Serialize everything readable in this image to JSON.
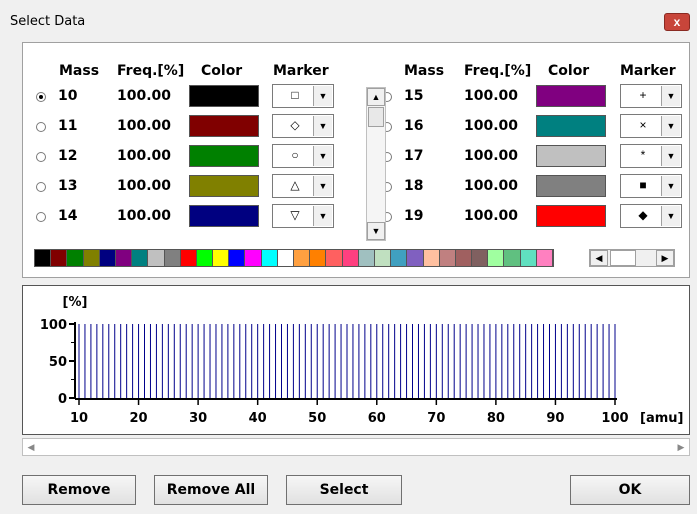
{
  "window": {
    "title": "Select Data",
    "close_label": "x"
  },
  "columns": {
    "mass": "Mass",
    "freq": "Freq.[%]",
    "color": "Color",
    "marker": "Marker"
  },
  "left_rows": [
    {
      "mass": "10",
      "freq": "100.00",
      "color": "#000000",
      "marker": "□",
      "selected": true
    },
    {
      "mass": "11",
      "freq": "100.00",
      "color": "#800000",
      "marker": "◇",
      "selected": false
    },
    {
      "mass": "12",
      "freq": "100.00",
      "color": "#008000",
      "marker": "○",
      "selected": false
    },
    {
      "mass": "13",
      "freq": "100.00",
      "color": "#808000",
      "marker": "△",
      "selected": false
    },
    {
      "mass": "14",
      "freq": "100.00",
      "color": "#000080",
      "marker": "▽",
      "selected": false
    }
  ],
  "right_rows": [
    {
      "mass": "15",
      "freq": "100.00",
      "color": "#800080",
      "marker": "+",
      "selected": false
    },
    {
      "mass": "16",
      "freq": "100.00",
      "color": "#008080",
      "marker": "×",
      "selected": false
    },
    {
      "mass": "17",
      "freq": "100.00",
      "color": "#c0c0c0",
      "marker": "*",
      "selected": false
    },
    {
      "mass": "18",
      "freq": "100.00",
      "color": "#808080",
      "marker": "■",
      "selected": false
    },
    {
      "mass": "19",
      "freq": "100.00",
      "color": "#ff0000",
      "marker": "◆",
      "selected": false
    }
  ],
  "palette": [
    "#000000",
    "#800000",
    "#008000",
    "#808000",
    "#000080",
    "#800080",
    "#008080",
    "#c0c0c0",
    "#808080",
    "#ff0000",
    "#00ff00",
    "#ffff00",
    "#0000ff",
    "#ff00ff",
    "#00ffff",
    "#ffffff",
    "#ffa040",
    "#ff8000",
    "#ff6060",
    "#ff4080",
    "#a0c0c0",
    "#c0e0c0",
    "#40a0c0",
    "#8060c0",
    "#ffc0a0",
    "#c08080",
    "#a06060",
    "#806060",
    "#a0ffa0",
    "#60c080",
    "#60e0c0",
    "#ff80c0"
  ],
  "chart_data": {
    "type": "bar",
    "ylabel": "[%]",
    "xlabel": "[amu]",
    "xlim": [
      10,
      100
    ],
    "ylim": [
      0,
      100
    ],
    "x_ticks": [
      "10",
      "20",
      "30",
      "40",
      "50",
      "60",
      "70",
      "80",
      "90",
      "100"
    ],
    "y_ticks": [
      "0",
      "50",
      "100"
    ],
    "x": [
      10,
      11,
      12,
      13,
      14,
      15,
      16,
      17,
      18,
      19,
      20,
      21,
      22,
      23,
      24,
      25,
      26,
      27,
      28,
      29,
      30,
      31,
      32,
      33,
      34,
      35,
      36,
      37,
      38,
      39,
      40,
      41,
      42,
      43,
      44,
      45,
      46,
      47,
      48,
      49,
      50,
      51,
      52,
      53,
      54,
      55,
      56,
      57,
      58,
      59,
      60,
      61,
      62,
      63,
      64,
      65,
      66,
      67,
      68,
      69,
      70,
      71,
      72,
      73,
      74,
      75,
      76,
      77,
      78,
      79,
      80,
      81,
      82,
      83,
      84,
      85,
      86,
      87,
      88,
      89,
      90,
      91,
      92,
      93,
      94,
      95,
      96,
      97,
      98,
      99,
      100
    ],
    "value": 100,
    "bar_color": "#00008b"
  },
  "buttons": {
    "remove": "Remove",
    "remove_all": "Remove All",
    "select": "Select",
    "ok": "OK"
  }
}
